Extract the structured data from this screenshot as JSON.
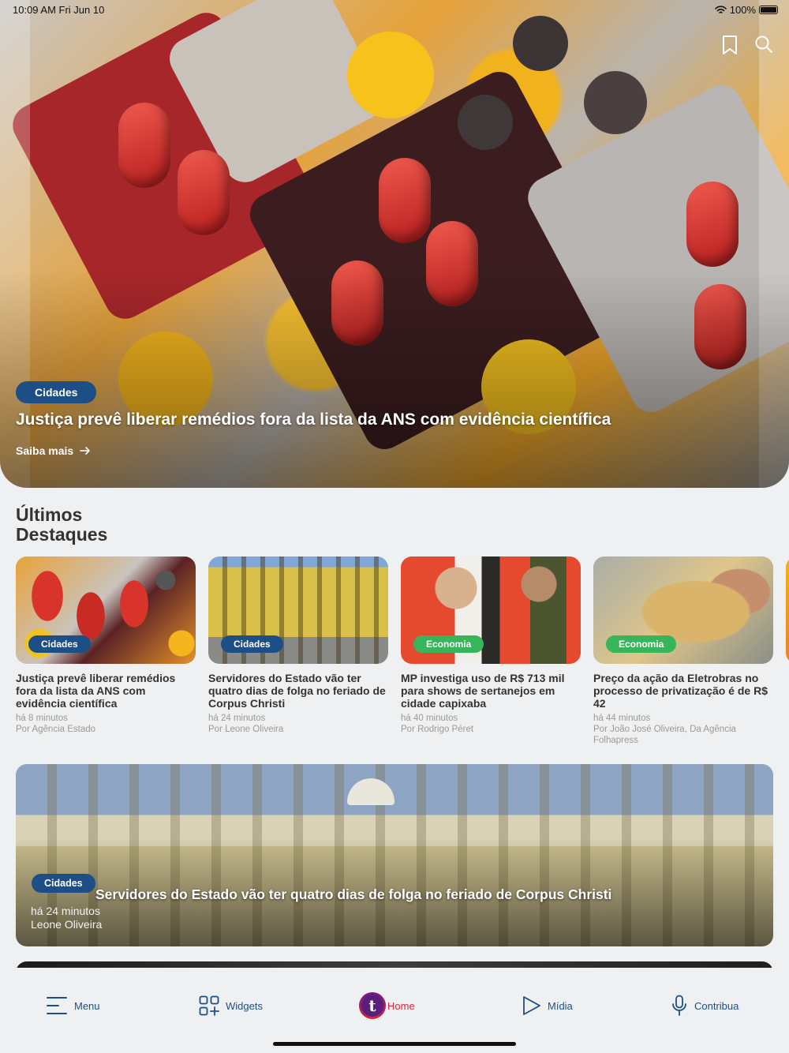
{
  "status_bar": {
    "time": "10:09 AM  Fri Jun 10",
    "battery": "100%"
  },
  "hero": {
    "category": "Cidades",
    "title": "Justiça prevê liberar remédios fora da lista da ANS com evidência científica",
    "more_label": "Saiba mais"
  },
  "section": {
    "title_line1": "Últimos",
    "title_line2": "Destaques"
  },
  "cards": [
    {
      "category": "Cidades",
      "title": "Justiça prevê liberar remédios fora da lista da ANS com evidência científica",
      "time": "há 8 minutos",
      "author": "Por Agência  Estado"
    },
    {
      "category": "Cidades",
      "title": "Servidores do Estado vão ter quatro dias de folga no feriado de Corpus Christi",
      "time": "há 24 minutos",
      "author": "Por Leone Oliveira"
    },
    {
      "category": "Economia",
      "title": "MP investiga uso de R$ 713 mil para shows de sertanejos em cidade capixaba",
      "time": "há 40 minutos",
      "author": "Por Rodrigo Péret"
    },
    {
      "category": "Economia",
      "title": "Preço da ação da Eletrobras no processo de privatização é de R$ 42",
      "time": "há 44 minutos",
      "author": "Por João José Oliveira, Da Agência Folhapress"
    }
  ],
  "feature": {
    "category": "Cidades",
    "title": "Servidores do Estado vão ter quatro dias de folga no feriado de Corpus Christi",
    "time": "há 24 minutos",
    "author": "Leone Oliveira"
  },
  "tabbar": {
    "menu": "Menu",
    "widgets": "Widgets",
    "home": "Home",
    "home_logo": "t",
    "media": "Mídia",
    "contribute": "Contribua"
  },
  "colors": {
    "primary": "#1d4f86",
    "accent": "#d9253a",
    "economia": "#38b45a"
  },
  "icons": [
    "bookmark-icon",
    "search-icon",
    "arrow-right-icon",
    "menu-icon",
    "widgets-icon",
    "play-icon",
    "microphone-icon",
    "wifi-icon",
    "battery-icon"
  ]
}
